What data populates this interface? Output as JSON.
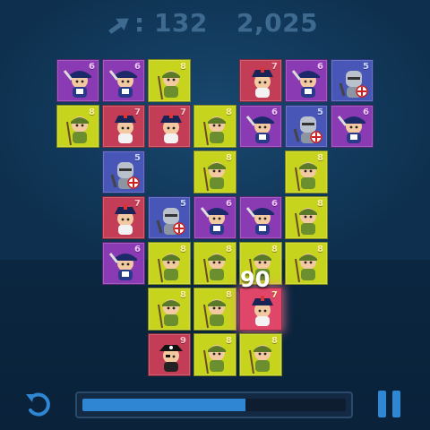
{
  "hud": {
    "moves": "132",
    "moves_separator": ":",
    "moves_icon": "swap-arrows-icon",
    "score": "2,025"
  },
  "floating_score": "90",
  "progress": {
    "fraction": 0.62,
    "color": "#2f86d3"
  },
  "colors": {
    "purple": "#8a3bb3",
    "yellow": "#c6d41d",
    "red": "#c43d56",
    "blue": "#4856b8",
    "highlight": "#e0456a"
  },
  "tiles": [
    {
      "row": 0,
      "col": 0,
      "color": "purple",
      "value": "6",
      "unit": "musketeer"
    },
    {
      "row": 0,
      "col": 1,
      "color": "purple",
      "value": "6",
      "unit": "musketeer"
    },
    {
      "row": 0,
      "col": 2,
      "color": "yellow",
      "value": "8",
      "unit": "soldier"
    },
    {
      "row": 0,
      "col": 4,
      "color": "red",
      "value": "7",
      "unit": "officer"
    },
    {
      "row": 0,
      "col": 5,
      "color": "purple",
      "value": "6",
      "unit": "musketeer"
    },
    {
      "row": 0,
      "col": 6,
      "color": "blue",
      "value": "5",
      "unit": "knight"
    },
    {
      "row": 1,
      "col": 0,
      "color": "yellow",
      "value": "8",
      "unit": "soldier"
    },
    {
      "row": 1,
      "col": 1,
      "color": "red",
      "value": "7",
      "unit": "officer"
    },
    {
      "row": 1,
      "col": 2,
      "color": "red",
      "value": "7",
      "unit": "officer"
    },
    {
      "row": 1,
      "col": 3,
      "color": "yellow",
      "value": "8",
      "unit": "soldier"
    },
    {
      "row": 1,
      "col": 4,
      "color": "purple",
      "value": "6",
      "unit": "musketeer"
    },
    {
      "row": 1,
      "col": 5,
      "color": "blue",
      "value": "5",
      "unit": "knight"
    },
    {
      "row": 1,
      "col": 6,
      "color": "purple",
      "value": "6",
      "unit": "musketeer"
    },
    {
      "row": 2,
      "col": 1,
      "color": "blue",
      "value": "5",
      "unit": "knight"
    },
    {
      "row": 2,
      "col": 3,
      "color": "yellow",
      "value": "8",
      "unit": "soldier"
    },
    {
      "row": 2,
      "col": 5,
      "color": "yellow",
      "value": "8",
      "unit": "soldier"
    },
    {
      "row": 3,
      "col": 1,
      "color": "red",
      "value": "7",
      "unit": "officer"
    },
    {
      "row": 3,
      "col": 2,
      "color": "blue",
      "value": "5",
      "unit": "knight"
    },
    {
      "row": 3,
      "col": 3,
      "color": "purple",
      "value": "6",
      "unit": "musketeer"
    },
    {
      "row": 3,
      "col": 4,
      "color": "purple",
      "value": "6",
      "unit": "musketeer"
    },
    {
      "row": 3,
      "col": 5,
      "color": "yellow",
      "value": "8",
      "unit": "soldier"
    },
    {
      "row": 4,
      "col": 1,
      "color": "purple",
      "value": "6",
      "unit": "musketeer"
    },
    {
      "row": 4,
      "col": 2,
      "color": "yellow",
      "value": "8",
      "unit": "soldier"
    },
    {
      "row": 4,
      "col": 3,
      "color": "yellow",
      "value": "8",
      "unit": "soldier"
    },
    {
      "row": 4,
      "col": 4,
      "color": "yellow",
      "value": "8",
      "unit": "soldier"
    },
    {
      "row": 4,
      "col": 5,
      "color": "yellow",
      "value": "8",
      "unit": "soldier"
    },
    {
      "row": 5,
      "col": 2,
      "color": "yellow",
      "value": "8",
      "unit": "soldier"
    },
    {
      "row": 5,
      "col": 3,
      "color": "yellow",
      "value": "8",
      "unit": "soldier"
    },
    {
      "row": 5,
      "col": 4,
      "color": "highlight",
      "value": "7",
      "unit": "officer"
    },
    {
      "row": 6,
      "col": 2,
      "color": "red",
      "value": "9",
      "unit": "pirate"
    },
    {
      "row": 6,
      "col": 3,
      "color": "yellow",
      "value": "8",
      "unit": "soldier"
    },
    {
      "row": 6,
      "col": 4,
      "color": "yellow",
      "value": "8",
      "unit": "soldier"
    }
  ]
}
